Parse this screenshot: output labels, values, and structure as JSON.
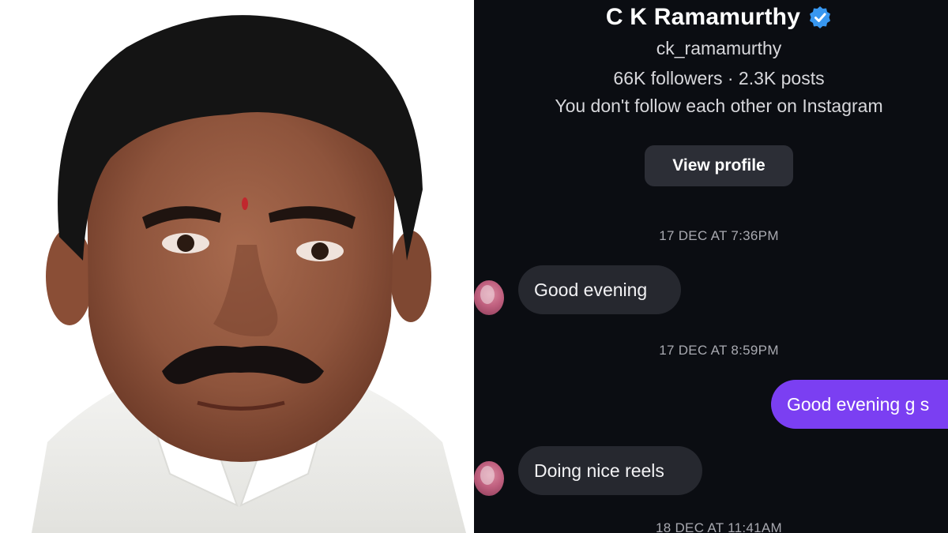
{
  "profile": {
    "name": "C K Ramamurthy",
    "username": "ck_ramamurthy",
    "stats": "66K followers · 2.3K posts",
    "follow_note": "You don't follow each other on Instagram",
    "view_profile_label": "View profile",
    "verified_icon": "verified-badge-icon"
  },
  "messages": [
    {
      "timestamp": "17 DEC AT 7:36PM",
      "from": "them",
      "text": "Good evening"
    },
    {
      "timestamp": "17 DEC AT 8:59PM",
      "from": "me",
      "text": "Good evening g s"
    },
    {
      "from": "them",
      "text": "Doing nice reels"
    },
    {
      "timestamp": "18 DEC AT 11:41AM"
    }
  ],
  "colors": {
    "chat_background": "#0b0d12",
    "incoming_bubble": "#26282f",
    "outgoing_bubble": "#7b3ff2",
    "verified_badge": "#3897f0",
    "button_background": "#2c2e36"
  }
}
